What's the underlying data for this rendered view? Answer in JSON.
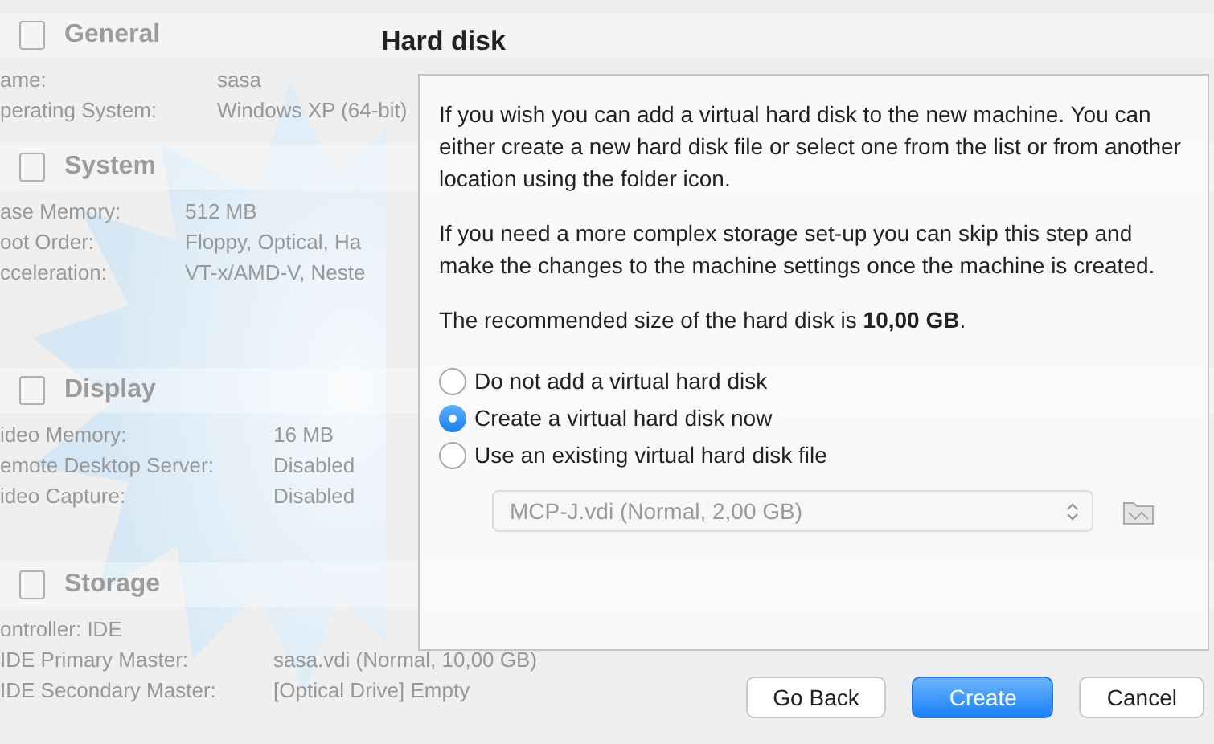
{
  "details": [
    {
      "title": "General",
      "rows": [
        {
          "label": "ame:",
          "value": "sasa"
        },
        {
          "label": "perating System:",
          "value": "Windows XP (64-bit)"
        }
      ]
    },
    {
      "title": "System",
      "rows": [
        {
          "label": "ase Memory:",
          "value": "512 MB"
        },
        {
          "label": "oot Order:",
          "value": "Floppy, Optical, Ha"
        },
        {
          "label": "cceleration:",
          "value": "VT-x/AMD-V, Neste"
        }
      ]
    },
    {
      "title": "Display",
      "rows": [
        {
          "label": "ideo Memory:",
          "value": "16 MB"
        },
        {
          "label": "emote Desktop Server:",
          "value": "Disabled"
        },
        {
          "label": "ideo Capture:",
          "value": "Disabled"
        }
      ]
    },
    {
      "title": "Storage",
      "rows": [
        {
          "label": "ontroller: IDE",
          "value": ""
        },
        {
          "label": "IDE Primary Master:",
          "value": "sasa.vdi (Normal, 10,00 GB)"
        },
        {
          "label": "IDE Secondary Master:",
          "value": "[Optical Drive] Empty"
        }
      ]
    }
  ],
  "dialog": {
    "title": "Hard disk",
    "paragraphs": [
      "If you wish you can add a virtual hard disk to the new machine. You can either create a new hard disk file or select one from the list or from another location using the folder icon.",
      "If you need a more complex storage set-up you can skip this step and make the changes to the machine settings once the machine is created.",
      "The recommended size of the hard disk is **10,00 GB**."
    ],
    "options": [
      {
        "label": "Do not add a virtual hard disk",
        "selected": false
      },
      {
        "label": "Create a virtual hard disk now",
        "selected": true
      },
      {
        "label": "Use an existing virtual hard disk file",
        "selected": false
      }
    ],
    "disk_select": {
      "value": "MCP-J.vdi (Normal, 2,00 GB)",
      "disabled": true
    },
    "buttons": [
      {
        "label": "Go Back",
        "kind": "normal"
      },
      {
        "label": "Create",
        "kind": "default"
      },
      {
        "label": "Cancel",
        "kind": "normal"
      }
    ]
  }
}
